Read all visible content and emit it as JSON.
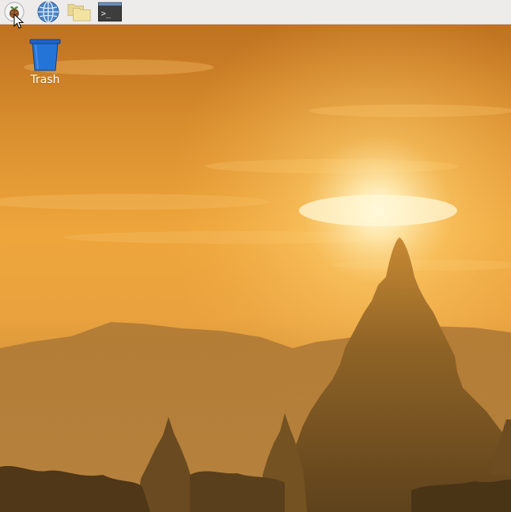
{
  "taskbar": {
    "background": "#edeceb",
    "launchers": [
      {
        "icon": "raspberry-pi-menu-icon",
        "tooltip": ""
      },
      {
        "icon": "web-browser-globe-icon",
        "tooltip": ""
      },
      {
        "icon": "file-manager-folders-icon",
        "tooltip": ""
      },
      {
        "icon": "terminal-icon",
        "tooltip": ""
      }
    ],
    "terminal_glyph": ">_"
  },
  "desktop": {
    "icons": [
      {
        "label": "Trash",
        "icon": "trash-bin-icon",
        "color": "#1e64c8"
      }
    ]
  },
  "wallpaper": {
    "description_colors": {
      "sky_top": "#c9781e",
      "sun_glow": "#fff3c8",
      "horizon": "#f0a63c",
      "silhouette": "#6b4a22"
    }
  }
}
